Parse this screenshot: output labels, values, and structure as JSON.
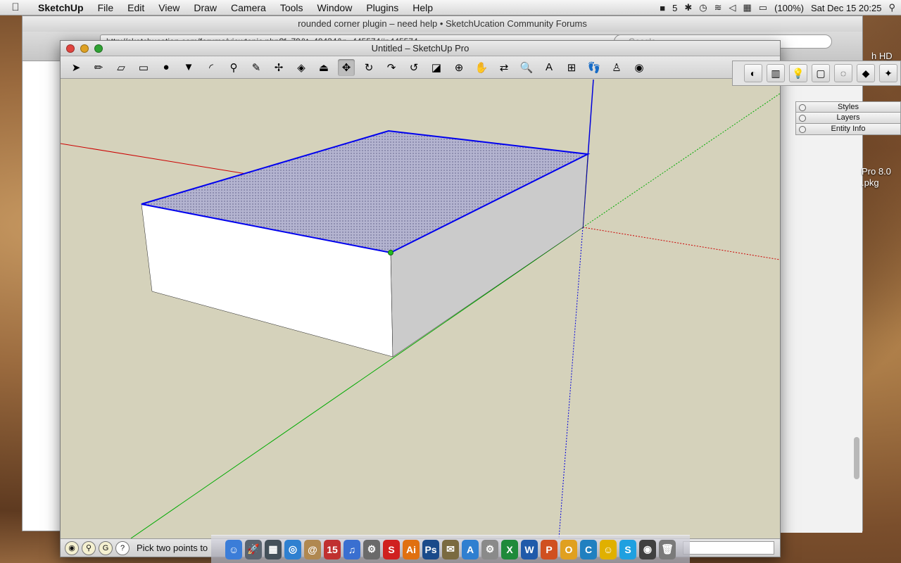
{
  "menubar": {
    "apple_icon": "apple-icon",
    "items": [
      "SketchUp",
      "File",
      "Edit",
      "View",
      "Draw",
      "Camera",
      "Tools",
      "Window",
      "Plugins",
      "Help"
    ],
    "status": {
      "adobe": "5",
      "battery": "(100%)",
      "clock": "Sat Dec 15  20:25"
    }
  },
  "browser": {
    "title": "rounded corner plugin – need help • SketchUcation Community Forums",
    "url": "http://sketchucation.com/forums/viewtopic.php?f=79&t=49434&p=445574#p445574",
    "search_placeholder": "Google"
  },
  "desktop": {
    "label_hd": "h HD",
    "label_pkg_line1": "Pro 8.0",
    "label_pkg_line2": ".pkg"
  },
  "trays": [
    "Styles",
    "Layers",
    "Entity Info"
  ],
  "sketchup": {
    "title": "Untitled – SketchUp Pro",
    "tools": [
      {
        "name": "select-tool",
        "glyph": "➤"
      },
      {
        "name": "pencil-tool",
        "glyph": "✏"
      },
      {
        "name": "eraser-tool",
        "glyph": "▱"
      },
      {
        "name": "rectangle-tool",
        "glyph": "▭"
      },
      {
        "name": "circle-tool",
        "glyph": "●"
      },
      {
        "name": "polygon-tool",
        "glyph": "▼"
      },
      {
        "name": "arc-tool",
        "glyph": "◜"
      },
      {
        "name": "tape-measure-tool",
        "glyph": "⚲"
      },
      {
        "name": "protractor-tool",
        "glyph": "✎"
      },
      {
        "name": "dimension-tool",
        "glyph": "✢"
      },
      {
        "name": "paint-bucket-tool",
        "glyph": "◈"
      },
      {
        "name": "push-pull-tool",
        "glyph": "⏏"
      },
      {
        "name": "move-tool",
        "glyph": "✥"
      },
      {
        "name": "rotate-tool",
        "glyph": "↻"
      },
      {
        "name": "follow-me-tool",
        "glyph": "↷"
      },
      {
        "name": "offset-tool",
        "glyph": "↺"
      },
      {
        "name": "section-plane-tool",
        "glyph": "◪"
      },
      {
        "name": "orbit-tool",
        "glyph": "⊕"
      },
      {
        "name": "pan-tool",
        "glyph": "✋"
      },
      {
        "name": "undo-redo-tool",
        "glyph": "⇄"
      },
      {
        "name": "zoom-tool",
        "glyph": "🔍"
      },
      {
        "name": "text-tool",
        "glyph": "A"
      },
      {
        "name": "axes-tool",
        "glyph": "⊞"
      },
      {
        "name": "walk-tool",
        "glyph": "👣"
      },
      {
        "name": "position-camera-tool",
        "glyph": "♙"
      },
      {
        "name": "look-around-tool",
        "glyph": "◉"
      }
    ],
    "active_tool_index": 12,
    "status_prompt": "Pick two points to"
  },
  "colors": {
    "viewport_bg": "#d5d2bb",
    "selection_blue": "#0000ee",
    "axis_red": "#cc0000",
    "axis_green": "#00aa00",
    "axis_blue": "#0000dd"
  },
  "palette_icons": [
    "shadow-icon",
    "components-icon",
    "lightbulb-icon",
    "scene-icon",
    "soften-icon",
    "materials-icon",
    "star-icon"
  ],
  "dock_icons": [
    {
      "name": "finder-icon",
      "glyph": "☺",
      "color": "#3b7dd8"
    },
    {
      "name": "launchpad-icon",
      "glyph": "🚀",
      "color": "#5a6470"
    },
    {
      "name": "mission-control-icon",
      "glyph": "▦",
      "color": "#44505a"
    },
    {
      "name": "safari-icon",
      "glyph": "◎",
      "color": "#2f80d0"
    },
    {
      "name": "contacts-icon",
      "glyph": "@",
      "color": "#b08850"
    },
    {
      "name": "calendar-icon",
      "glyph": "15",
      "color": "#c03030"
    },
    {
      "name": "itunes-icon",
      "glyph": "♫",
      "color": "#3a6fd0"
    },
    {
      "name": "utility-icon",
      "glyph": "⚙",
      "color": "#6a6a6a"
    },
    {
      "name": "sketchup-icon",
      "glyph": "S",
      "color": "#d02020"
    },
    {
      "name": "illustrator-icon",
      "glyph": "Ai",
      "color": "#e07010"
    },
    {
      "name": "photoshop-icon",
      "glyph": "Ps",
      "color": "#1a4a8a"
    },
    {
      "name": "preview-icon",
      "glyph": "✉",
      "color": "#7a6a40"
    },
    {
      "name": "app-store-icon",
      "glyph": "A",
      "color": "#2f7fd0"
    },
    {
      "name": "system-prefs-icon",
      "glyph": "⚙",
      "color": "#8a8a8a"
    },
    {
      "name": "excel-icon",
      "glyph": "X",
      "color": "#1f8a3a"
    },
    {
      "name": "word-icon",
      "glyph": "W",
      "color": "#1f5aaa"
    },
    {
      "name": "powerpoint-icon",
      "glyph": "P",
      "color": "#d05020"
    },
    {
      "name": "outlook-icon",
      "glyph": "O",
      "color": "#e0a020"
    },
    {
      "name": "communicator-icon",
      "glyph": "C",
      "color": "#2080c0"
    },
    {
      "name": "messenger-icon",
      "glyph": "☺",
      "color": "#e0b000"
    },
    {
      "name": "skype-icon",
      "glyph": "S",
      "color": "#1fa0e0"
    },
    {
      "name": "camera-icon",
      "glyph": "◉",
      "color": "#404040"
    },
    {
      "name": "trash-icon",
      "glyph": "🗑",
      "color": "#7a7a7a"
    }
  ]
}
